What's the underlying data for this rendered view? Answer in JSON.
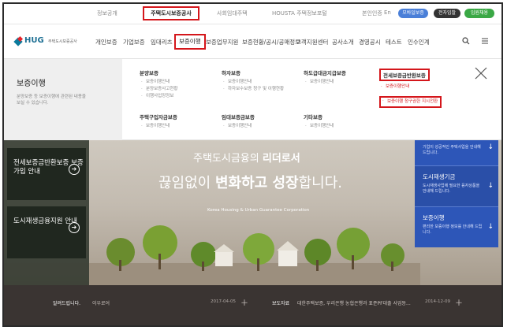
{
  "util_bar": {
    "links": [
      "정보공개",
      "사회임대주택",
      "HOUSTA 주택정보포털"
    ],
    "highlight": "주택도시보증공사",
    "lang": [
      "본인인증",
      "En"
    ],
    "pills": [
      {
        "label": "모바일보증",
        "color": "#4a7fd8"
      },
      {
        "label": "전자입찰",
        "color": "#333333"
      },
      {
        "label": "임원채용",
        "color": "#3aa845"
      }
    ]
  },
  "logo": {
    "main": "HUG",
    "sub": "주택도시보증공사"
  },
  "nav": {
    "items": [
      "개인보증",
      "기업보증",
      "임대리츠",
      "보증이행",
      "보증업무지원",
      "보증현황/공시/공매정보",
      "고객지원센터",
      "공사소개",
      "경영공시",
      "테스트",
      "인수인계"
    ],
    "active_index": 3,
    "search_icon": "search-icon",
    "menu_icon": "menu-icon"
  },
  "mega": {
    "title": "보증이행",
    "desc": "분양보증 등 보증이행에 관련된 내용을 보실 수 있습니다.",
    "columns": [
      {
        "head": "분양보증",
        "subs": [
          "보증이행안내",
          "분양보증사고현황",
          "이행사업장정보"
        ]
      },
      {
        "head": "주택구입자금보증",
        "subs": [
          "보증이행안내"
        ]
      },
      {
        "head": "하자보증",
        "subs": [
          "보증이행안내",
          "하자보수보증 청구 및 이행현황"
        ]
      },
      {
        "head": "임대보증금보증",
        "subs": [
          "보증이행안내"
        ]
      },
      {
        "head": "하도급대금지급보증",
        "subs": [
          "보증이행안내"
        ]
      },
      {
        "head": "기타보증",
        "subs": [
          "보증이행안내"
        ]
      },
      {
        "head": "전세보증금반환보증",
        "subs": [
          "보증이행안내",
          "보증이행 청구권한 지시전환"
        ]
      }
    ]
  },
  "hero": {
    "side_cards": [
      "전세보증금반환보증 보증가입 안내",
      "도시재생금융지원 안내"
    ],
    "tagline1_pre": "주택도시금융의 ",
    "tagline1_bold": "리더로서",
    "tagline2_pre": "끊임없이 ",
    "tagline2_bold": "변화하고 성장",
    "tagline2_post": "합니다.",
    "eng": "Korea Housing & Urban Guarantee Corporation",
    "right_cards": [
      {
        "title": "",
        "desc": "기업이 성공적인 주택사업을 안내해 드립니다."
      },
      {
        "title": "도시재생기금",
        "desc": "도시재생사업에 필요한 융자상품을 안내해 드립니다."
      },
      {
        "title": "보증이행",
        "desc": "편리한 보증이행 정보를 안내해 드립니다."
      }
    ]
  },
  "news": [
    {
      "label": "알려드립니다.",
      "text": "이우로어",
      "date": "2017-04-05"
    },
    {
      "label": "보도자료",
      "text": "대한주택보증, 우리은행 농협은행과 표준PF대출 사업동...",
      "date": "2014-12-09"
    }
  ]
}
